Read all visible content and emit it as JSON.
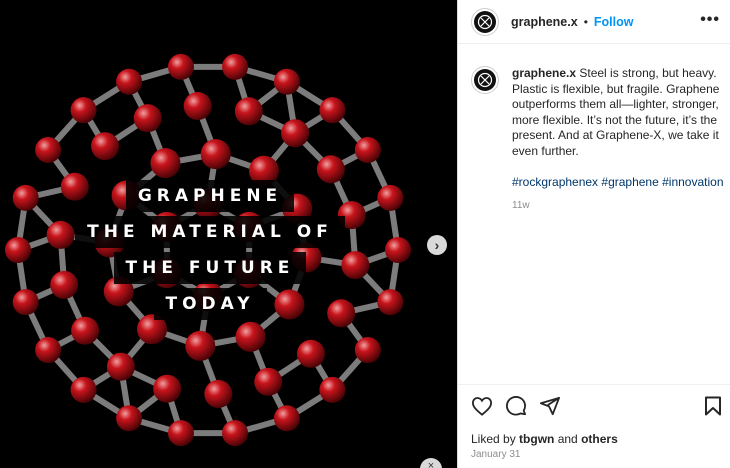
{
  "post": {
    "username": "graphene.x",
    "separator": "•",
    "follow_label": "Follow",
    "more_icon": "more-horizontal-icon",
    "caption_username": "graphene.x",
    "caption_text": "Steel is strong, but heavy. Plastic is flexible, but fragile. Graphene outperforms them all—lighter, stronger, more flexible. It’s not the future, it’s the present. And at Graphene-X, we take it even further.",
    "hashtags": "#rockgraphenex #graphene #innovation",
    "age": "11w",
    "liked_by_prefix": "Liked by ",
    "liked_by_user": "tbgwn",
    "liked_by_and": " and ",
    "liked_by_others": "others",
    "date": "January 31"
  },
  "media": {
    "overlay_lines": [
      "GRAPHENE",
      "THE MATERIAL OF",
      "THE FUTURE",
      "TODAY"
    ],
    "next_icon": "chevron-right-icon",
    "bottom_chip_icon": "close-icon"
  },
  "colors": {
    "accent": "#0095f6",
    "hashtag": "#00376b",
    "atom": "#c8141c",
    "background_media": "#000000"
  }
}
